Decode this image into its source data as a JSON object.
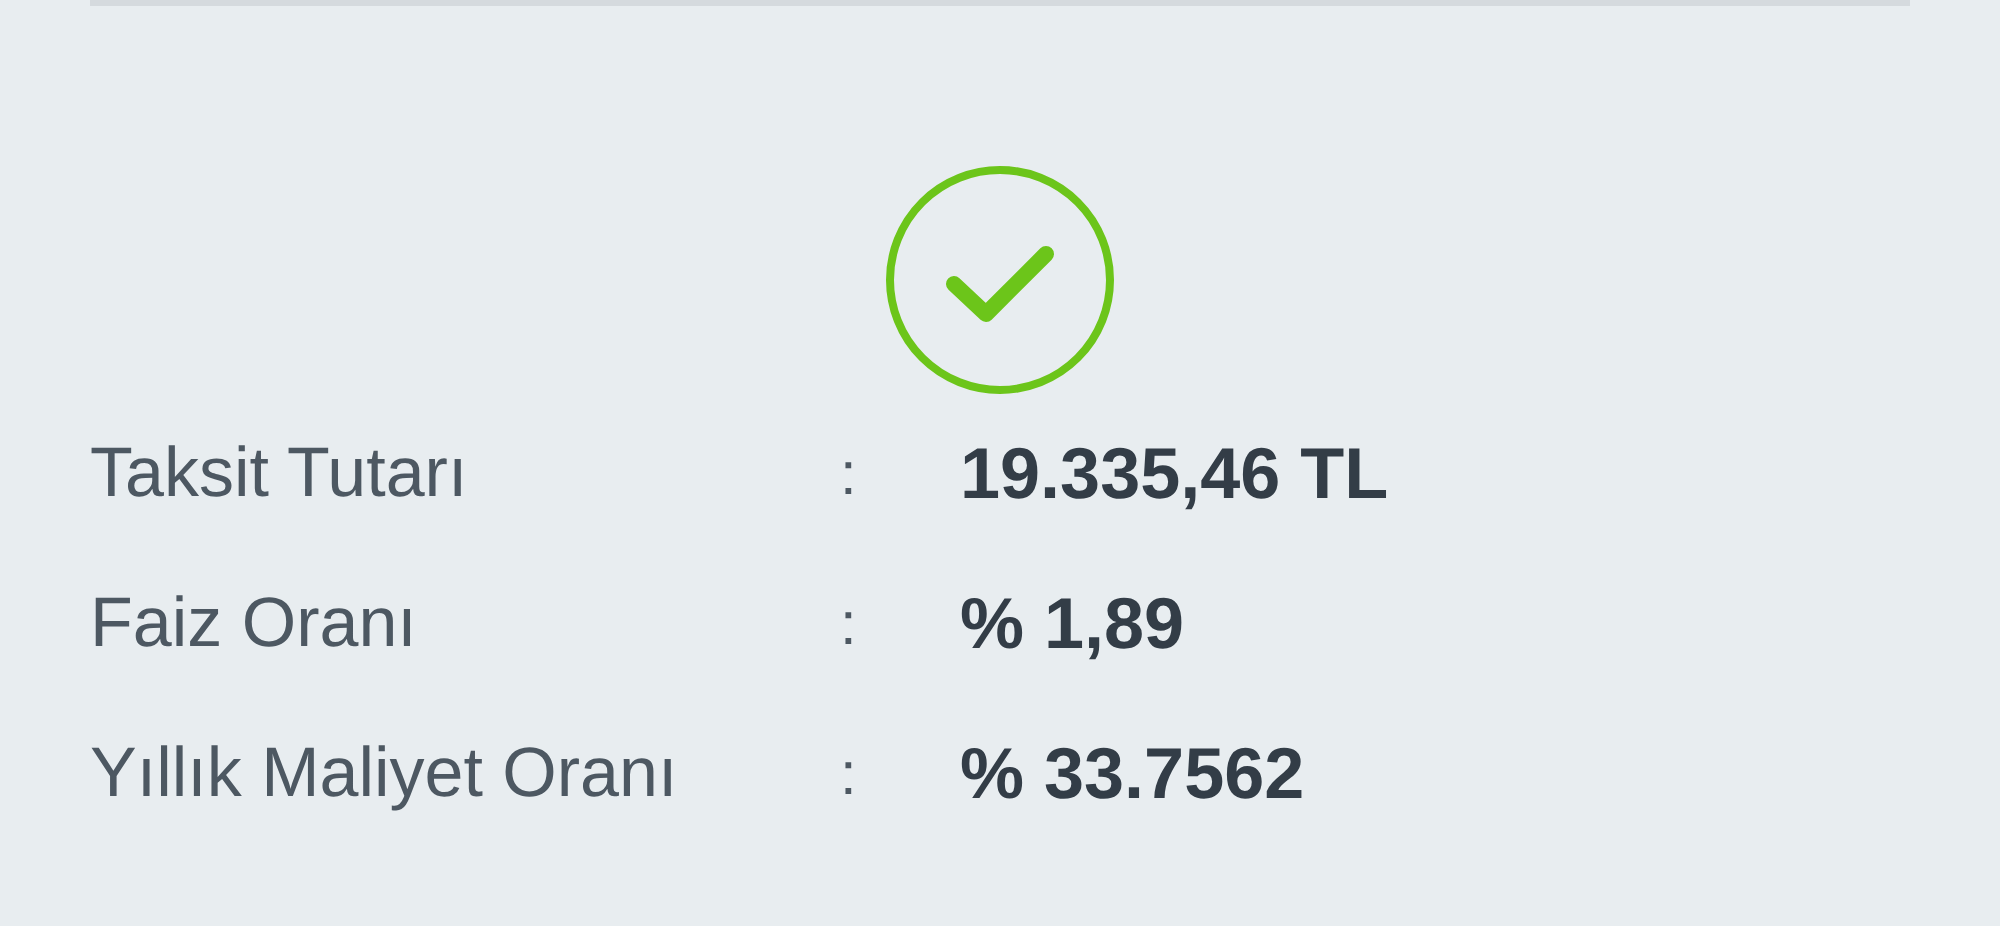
{
  "status": {
    "kind": "success"
  },
  "details": [
    {
      "label": "Taksit Tutarı",
      "separator": ":",
      "value": "19.335,46 TL"
    },
    {
      "label": "Faiz Oranı",
      "separator": ":",
      "value": "% 1,89"
    },
    {
      "label": "Yıllık Maliyet Oranı",
      "separator": ":",
      "value": "% 33.7562"
    }
  ]
}
